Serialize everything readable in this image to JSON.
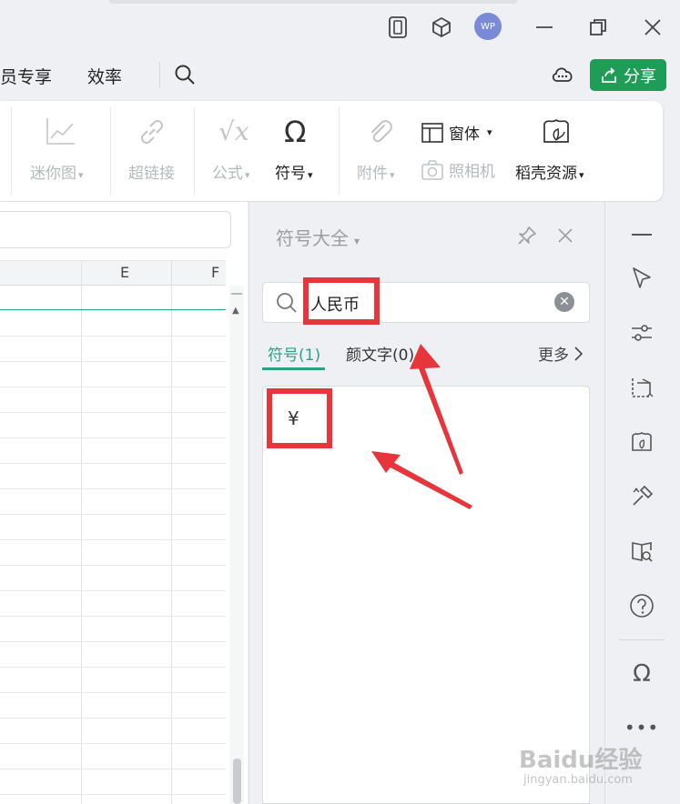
{
  "titlebar": {
    "avatar_text": "WP"
  },
  "menu": {
    "item_member": "员专享",
    "item_efficiency": "效率",
    "share_label": "分享"
  },
  "ribbon": {
    "sparkline": "迷你图",
    "hyperlink": "超链接",
    "formula": "公式",
    "symbol": "符号",
    "attachment": "附件",
    "window": "窗体",
    "camera": "照相机",
    "resources": "稻壳资源"
  },
  "sheet": {
    "columns": [
      "E",
      "F"
    ]
  },
  "symbol_panel": {
    "title": "符号大全",
    "search_value": "人民币",
    "tabs": [
      {
        "label": "符号(1)",
        "active": true
      },
      {
        "label": "颜文字(0)",
        "active": false
      }
    ],
    "more_label": "更多",
    "results": [
      "¥"
    ]
  },
  "watermark": {
    "text": "Baidu经验",
    "sub": "jingyan.baidu.com"
  },
  "colors": {
    "accent_green": "#1f9d57",
    "tab_green": "#27a386",
    "annotation_red": "#e8343b"
  }
}
